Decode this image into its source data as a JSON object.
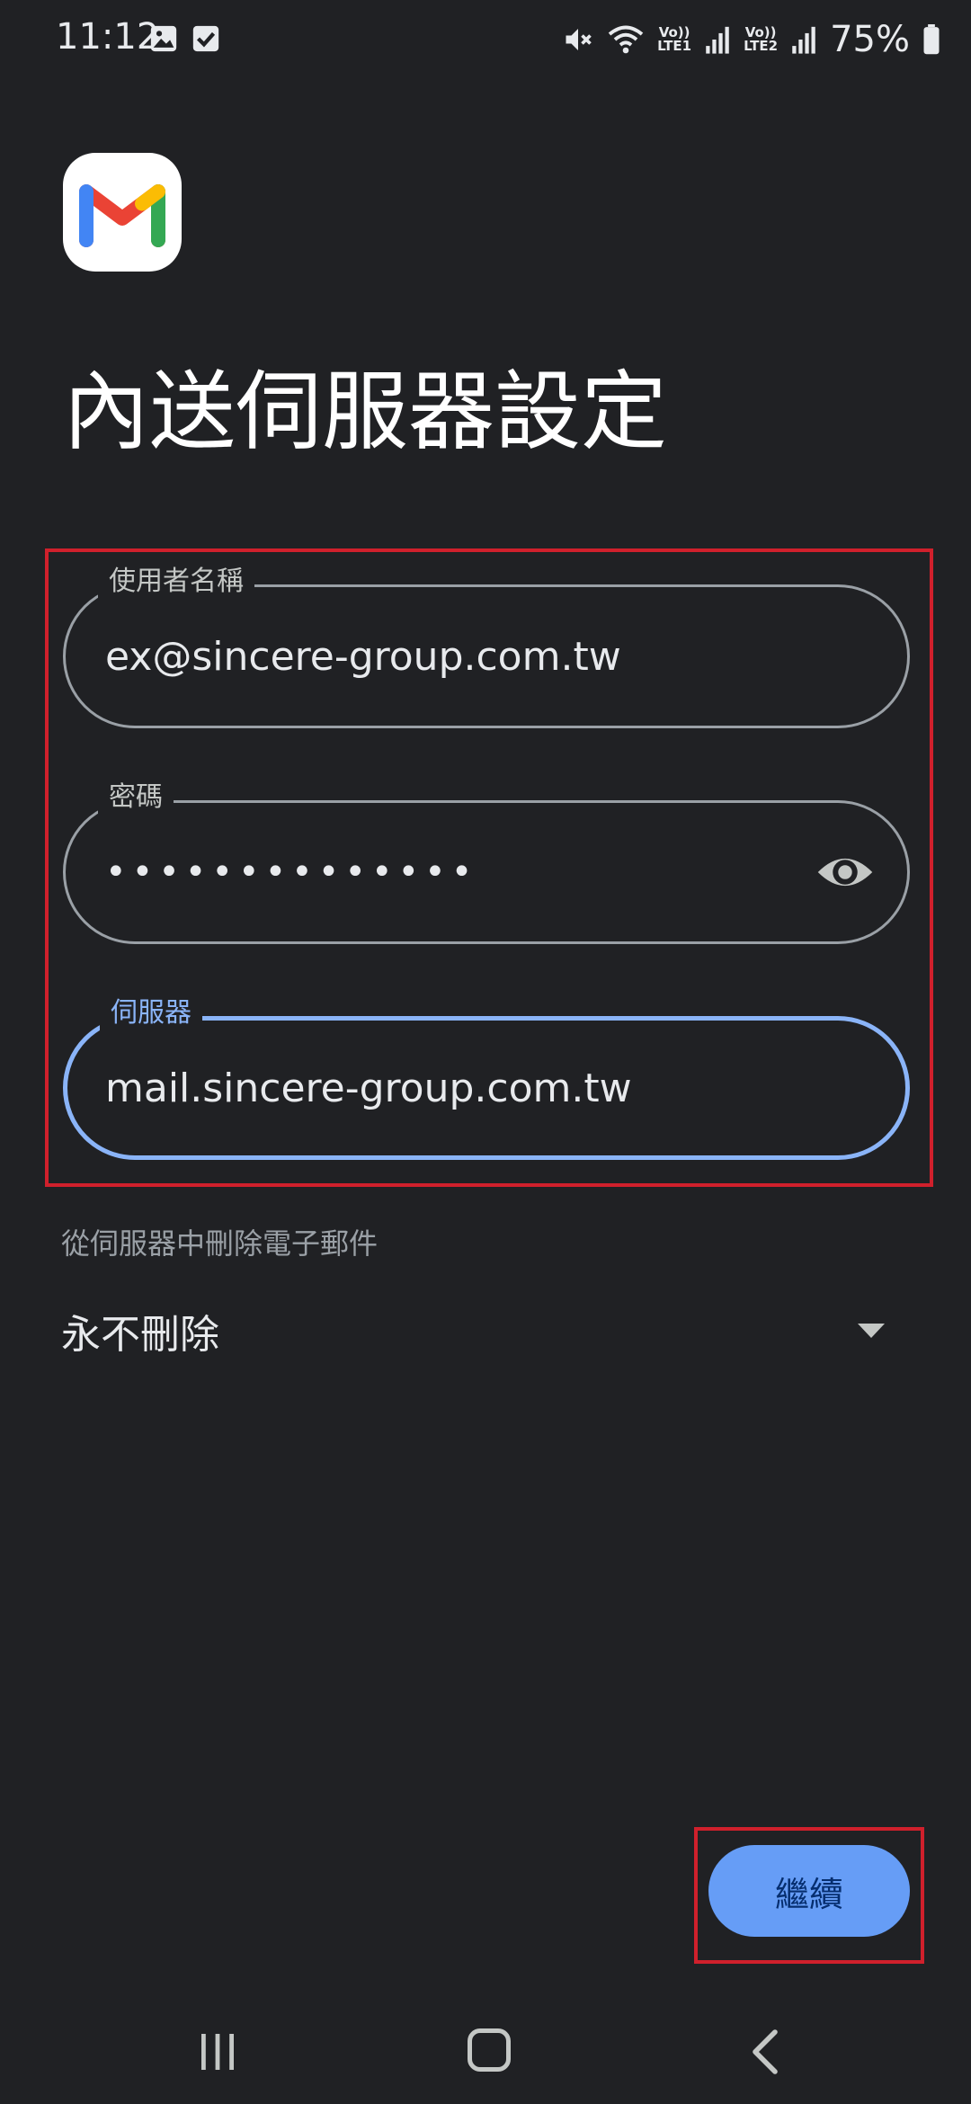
{
  "status_bar": {
    "time": "11:12",
    "lte1": "LTE1",
    "lte2": "LTE2",
    "vo1": "Vo))",
    "vo2": "Vo))",
    "battery": "75%",
    "icons": [
      "image-icon",
      "check-box-icon",
      "mute-icon",
      "wifi-icon",
      "signal-icon",
      "signal-icon",
      "battery-icon"
    ]
  },
  "app": {
    "logo": "gmail-logo"
  },
  "page": {
    "title": "內送伺服器設定"
  },
  "form": {
    "username": {
      "label": "使用者名稱",
      "value": "ex@sincere-group.com.tw"
    },
    "password": {
      "label": "密碼",
      "value": "••••••••••••••",
      "toggle_icon": "eye-icon"
    },
    "server": {
      "label": "伺服器",
      "value": "mail.sincere-group.com.tw"
    }
  },
  "delete_option": {
    "caption": "從伺服器中刪除電子郵件",
    "selected": "永不刪除"
  },
  "actions": {
    "continue_label": "繼續"
  },
  "colors": {
    "background": "#202124",
    "accent": "#8ab4f8",
    "button": "#669df6",
    "annotation": "#d0202c"
  }
}
